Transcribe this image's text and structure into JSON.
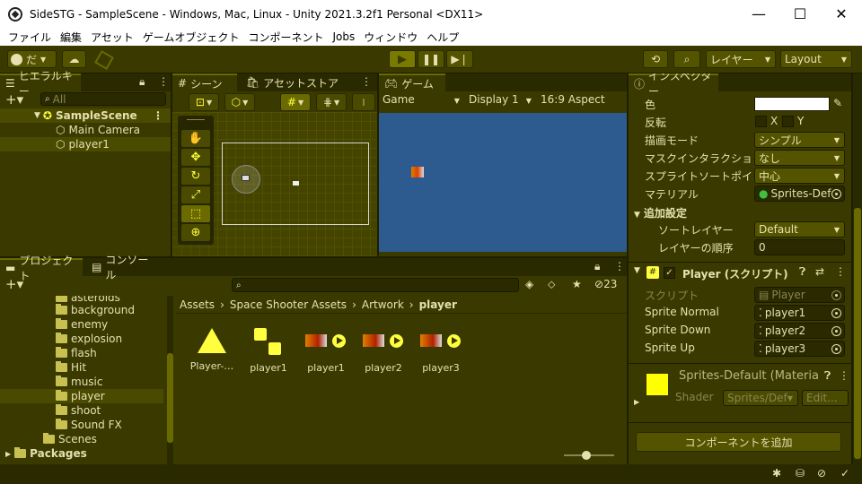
{
  "window": {
    "title": "SideSTG - SampleScene - Windows, Mac, Linux - Unity 2021.3.2f1 Personal <DX11>"
  },
  "menu": [
    "ファイル",
    "編集",
    "アセット",
    "ゲームオブジェクト",
    "コンポーネント",
    "Jobs",
    "ウィンドウ",
    "ヘルプ"
  ],
  "toolbar": {
    "account": "だ",
    "layers": "レイヤー",
    "layout": "Layout"
  },
  "hierarchy": {
    "tab": "ヒエラルキー",
    "search_placeholder": "All",
    "scene": "SampleScene",
    "items": [
      "Main Camera",
      "player1"
    ]
  },
  "scene_tabs": {
    "scene": "シーン",
    "asset_store": "アセットストア",
    "game": "ゲーム"
  },
  "game_bar": {
    "display_mode": "Game",
    "display": "Display 1",
    "aspect": "16:9 Aspect"
  },
  "project": {
    "tab": "プロジェクト",
    "console_tab": "コンソール",
    "hidden_count": "23",
    "folders": [
      "asteroids",
      "background",
      "enemy",
      "explosion",
      "flash",
      "Hit",
      "music",
      "player",
      "shoot",
      "Sound FX"
    ],
    "scenes": "Scenes",
    "packages": "Packages",
    "breadcrumb": [
      "Assets",
      "Space Shooter Assets",
      "Artwork",
      "player"
    ],
    "assets": [
      "Player-…",
      "player1",
      "player1",
      "player2",
      "player3"
    ]
  },
  "inspector": {
    "tab": "インスペクター",
    "sprite_renderer": {
      "color_label": "色",
      "flip_label": "反転",
      "flip_x": "X",
      "flip_y": "Y",
      "draw_mode_label": "描画モード",
      "draw_mode": "シンプル",
      "mask_label": "マスクインタラクション",
      "mask": "なし",
      "sort_point_label": "スプライトソートポイント",
      "sort_point": "中心",
      "material_label": "マテリアル",
      "material": "Sprites-Def",
      "additional_label": "追加設定",
      "sorting_layer_label": "ソートレイヤー",
      "sorting_layer": "Default",
      "order_label": "レイヤーの順序",
      "order": "0"
    },
    "script": {
      "title": "Player (スクリプト)",
      "script_label": "スクリプト",
      "script_value": "Player",
      "fields": [
        {
          "label": "Sprite Normal",
          "value": "player1"
        },
        {
          "label": "Sprite Down",
          "value": "player2"
        },
        {
          "label": "Sprite Up",
          "value": "player3"
        }
      ]
    },
    "material": {
      "title": "Sprites-Default (Materia",
      "shader_label": "Shader",
      "shader": "Sprites/Def",
      "edit": "Edit..."
    },
    "add_component": "コンポーネントを追加"
  },
  "colors": {
    "accent": "#ffff40",
    "panel": "#3a3a00",
    "scene_bg": "#2d5a8f"
  }
}
